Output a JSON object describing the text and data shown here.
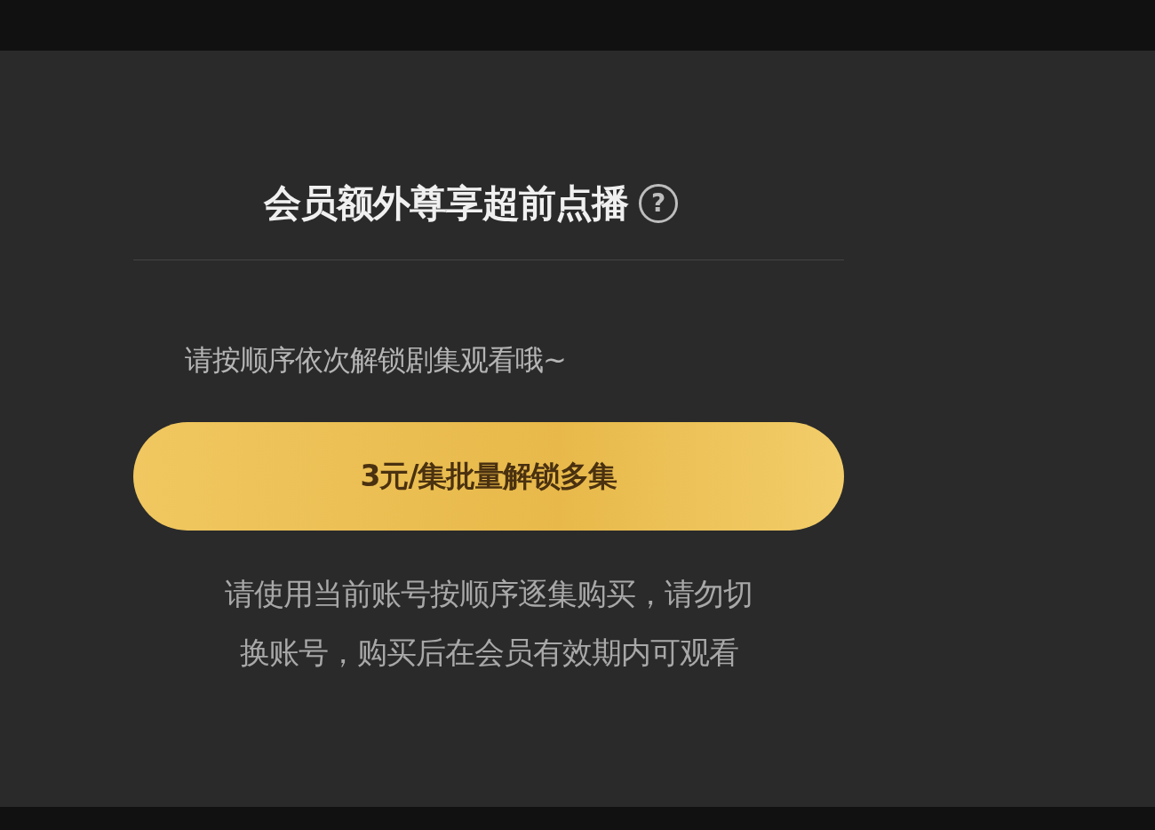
{
  "title": "会员额外尊享超前点播",
  "help_icon": "?",
  "hint": "请按顺序依次解锁剧集观看哦~",
  "button": "3元/集批量解锁多集",
  "note_lines": [
    "请使用当前账号按顺序逐集购买，请勿切",
    "换账号，购买后在会员有效期内可观看"
  ]
}
